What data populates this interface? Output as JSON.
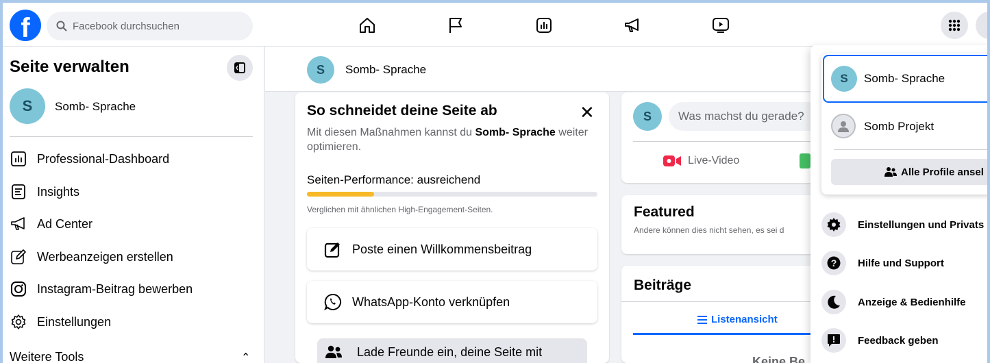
{
  "topbar": {
    "logo_letter": "f",
    "search_placeholder": "Facebook durchsuchen",
    "nav_icons": [
      "home-icon",
      "flag-icon",
      "dashboard-icon",
      "megaphone-icon",
      "video-icon"
    ],
    "right_icons": [
      "menu-grid-icon",
      "account-avatar-icon"
    ]
  },
  "sidebar": {
    "title": "Seite verwalten",
    "page_initial": "S",
    "page_name": "Somb- Sprache",
    "items": [
      {
        "label": "Professional-Dashboard",
        "icon": "dashboard-icon"
      },
      {
        "label": "Insights",
        "icon": "insights-icon"
      },
      {
        "label": "Ad Center",
        "icon": "megaphone-icon"
      },
      {
        "label": "Werbeanzeigen erstellen",
        "icon": "pencil-icon"
      },
      {
        "label": "Instagram-Beitrag bewerben",
        "icon": "instagram-icon"
      },
      {
        "label": "Einstellungen",
        "icon": "gear-icon"
      }
    ],
    "more_tools": "Weitere Tools"
  },
  "page_header": {
    "initial": "S",
    "name": "Somb- Sprache"
  },
  "performance": {
    "title": "So schneidet deine Seite ab",
    "subtitle_prefix": "Mit diesen Maßnahmen kannst du ",
    "subtitle_page": "Somb- Sprache",
    "subtitle_suffix": " weiter optimieren.",
    "label": "Seiten-Performance: ausreichend",
    "progress_fraction": 0.23,
    "note": "Verglichen mit ähnlichen High-Engagement-Seiten.",
    "tasks": [
      {
        "label": "Poste einen Willkommensbeitrag",
        "icon": "edit-icon"
      },
      {
        "label": "WhatsApp-Konto verknüpfen",
        "icon": "whatsapp-icon"
      },
      {
        "label": "Lade Freunde ein, deine Seite mit",
        "icon": "friends-icon"
      }
    ]
  },
  "composer": {
    "initial": "S",
    "placeholder": "Was machst du gerade?",
    "live_video": "Live-Video"
  },
  "featured": {
    "title": "Featured",
    "subtitle": "Andere können dies nicht sehen, es sei d"
  },
  "posts": {
    "title": "Beiträge",
    "tab_list": "Listenansicht",
    "cut_text": "Keine Be"
  },
  "dropdown": {
    "profiles": [
      {
        "initial": "S",
        "name": "Somb- Sprache"
      },
      {
        "name": "Somb Projekt"
      }
    ],
    "all_profiles": "Alle Profile ansel",
    "menu": [
      {
        "label": "Einstellungen und Privats",
        "icon": "gear-icon"
      },
      {
        "label": "Hilfe und Support",
        "icon": "help-icon"
      },
      {
        "label": "Anzeige & Bedienhilfe",
        "icon": "moon-icon"
      },
      {
        "label": "Feedback geben",
        "icon": "feedback-icon"
      }
    ]
  },
  "colors": {
    "brand": "#0866ff",
    "progress": "#f7b928",
    "avatar": "#7ec5d8"
  }
}
